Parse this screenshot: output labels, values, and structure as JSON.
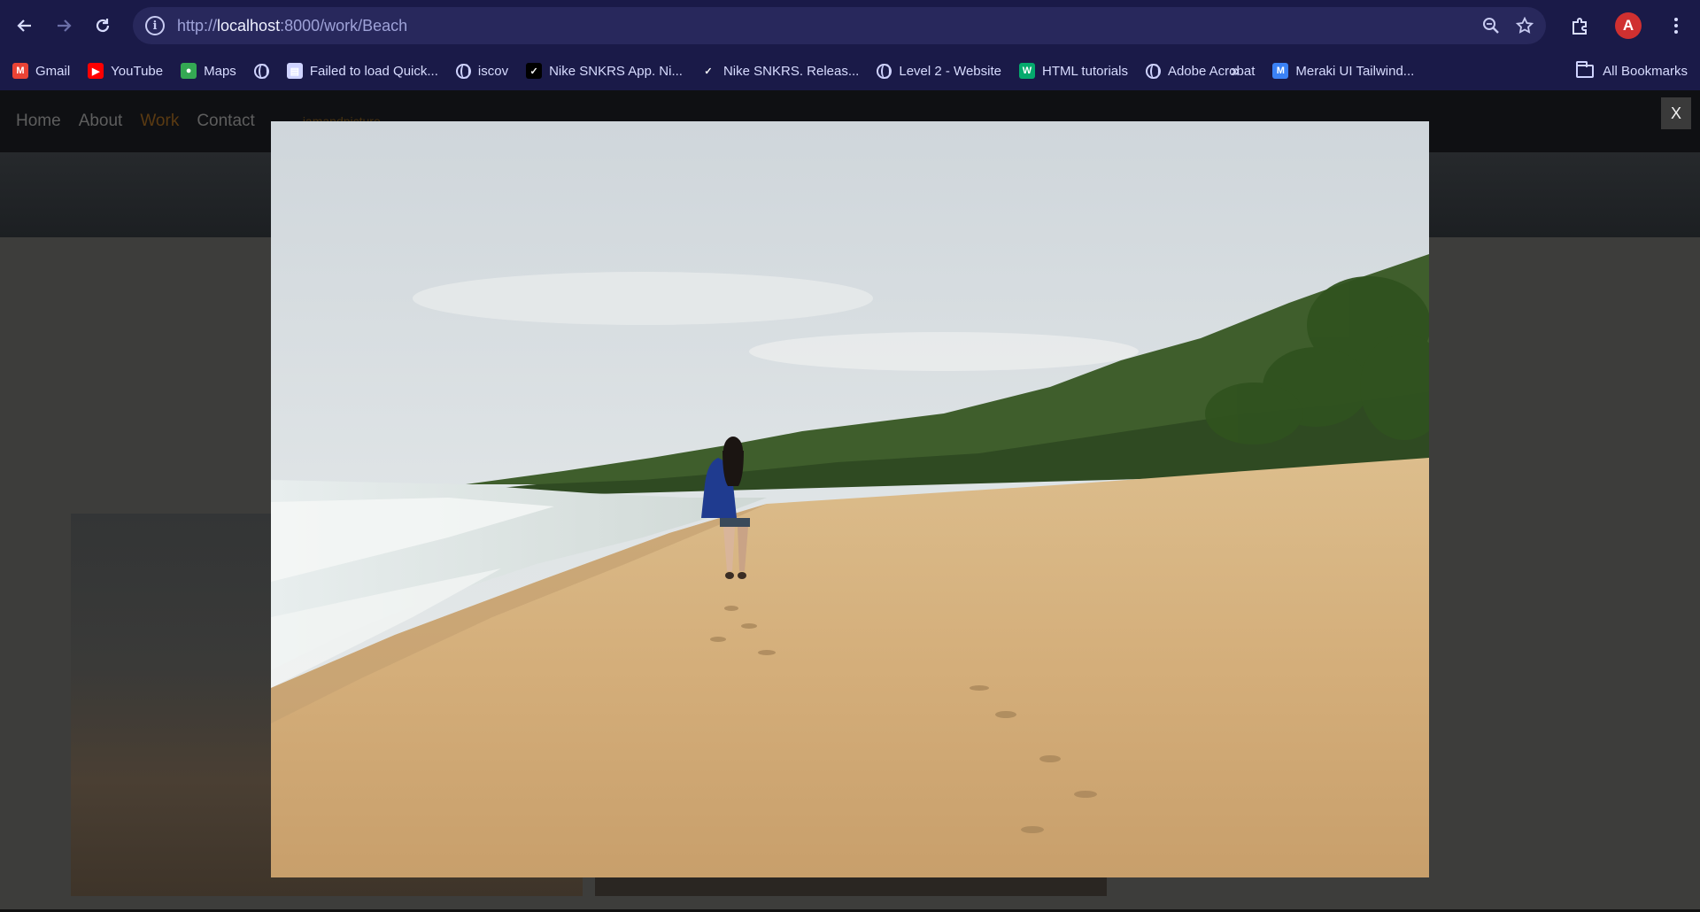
{
  "browser": {
    "url_prefix": "http://",
    "url_host": "localhost",
    "url_rest": ":8000/work/Beach",
    "profile_letter": "A",
    "bookmarks": [
      {
        "label": "Gmail",
        "icon": "gmail-icon",
        "color": "#ea4335"
      },
      {
        "label": "YouTube",
        "icon": "youtube-icon",
        "color": "#ff0000"
      },
      {
        "label": "Maps",
        "icon": "maps-icon",
        "color": "#34a853"
      },
      {
        "label": "",
        "icon": "globe-icon",
        "color": "#cfd3ff"
      },
      {
        "label": "Failed to load Quick...",
        "icon": "page-icon",
        "color": "#cfd3ff"
      },
      {
        "label": "iscov",
        "icon": "globe-icon",
        "color": "#cfd3ff"
      },
      {
        "label": "Nike SNKRS App. Ni...",
        "icon": "nike-icon",
        "color": "#000000"
      },
      {
        "label": "Nike SNKRS. Releas...",
        "icon": "nike-icon",
        "color": "#1a1a48"
      },
      {
        "label": "Level 2 - Website",
        "icon": "globe-icon",
        "color": "#cfd3ff"
      },
      {
        "label": "HTML tutorials",
        "icon": "w3schools-icon",
        "color": "#04aa6d"
      },
      {
        "label": "Adobe Acrobat",
        "icon": "globe-icon",
        "color": "#cfd3ff"
      },
      {
        "label": "Meraki UI Tailwind...",
        "icon": "meraki-icon",
        "color": "#3b82f6"
      }
    ],
    "more_label": "»",
    "all_bookmarks_label": "All Bookmarks"
  },
  "site": {
    "nav": [
      "Home",
      "About",
      "Work",
      "Contact"
    ],
    "active_index": 2,
    "logo_text": "iamandpicture"
  },
  "lightbox": {
    "close_label": "X"
  },
  "colors": {
    "chrome_bg": "#1a1a48",
    "omnibox_bg": "#28285c",
    "overlay_bg": "#3d3d3b",
    "sand": "#d4ae7a",
    "sky": "#dfe4e6"
  }
}
